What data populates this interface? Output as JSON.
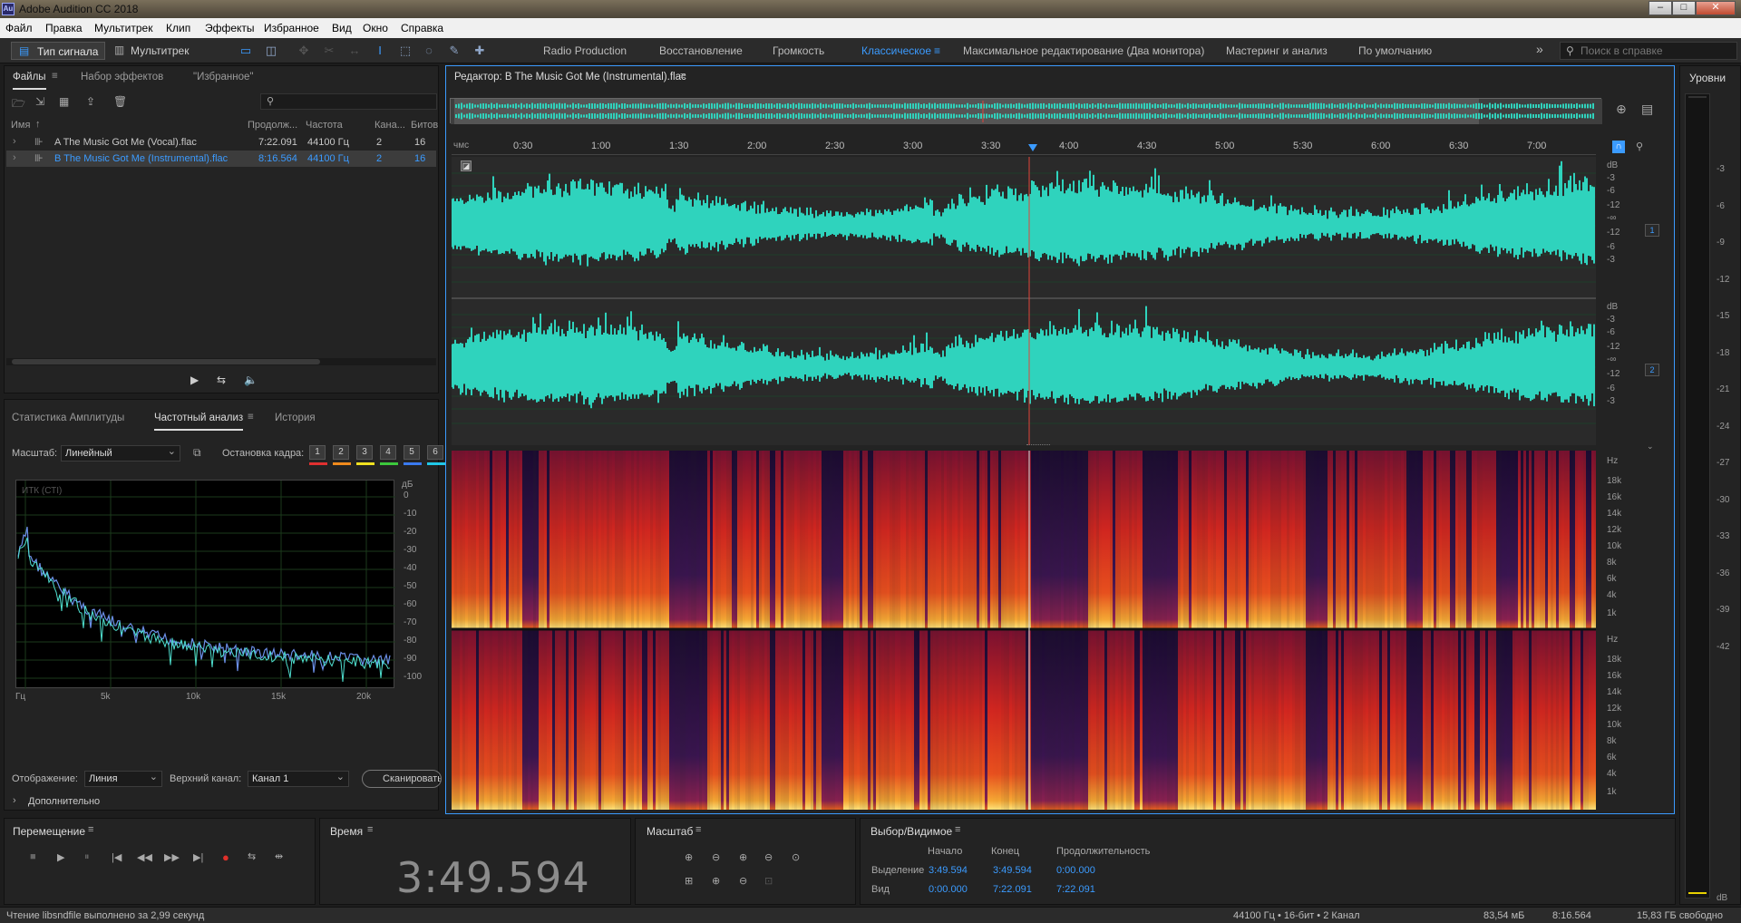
{
  "app": {
    "title": "Adobe Audition CC 2018",
    "logo": "Au"
  },
  "window_buttons": [
    "–",
    "□",
    "✕"
  ],
  "menu": [
    "Файл",
    "Правка",
    "Мультитрек",
    "Клип",
    "Эффекты",
    "Избранное",
    "Вид",
    "Окно",
    "Справка"
  ],
  "toolbar": {
    "mode_waveform": "Тип сигнала",
    "mode_multitrack": "Мультитрек",
    "workspaces": [
      "Radio Production",
      "Восстановление",
      "Громкость",
      "Классическое",
      "Максимальное редактирование (Два монитора)",
      "Мастеринг и анализ",
      "По умолчанию"
    ],
    "active_workspace": "Классическое",
    "more": "»",
    "search_placeholder": "Поиск в справке"
  },
  "files_panel": {
    "tabs": [
      "Файлы",
      "Набор эффектов",
      "\"Избранное\""
    ],
    "columns": [
      "Имя",
      "Продолж...",
      "Частота",
      "Кана...",
      "Битов"
    ],
    "rows": [
      {
        "name": "A The Music Got Me (Vocal).flac",
        "duration": "7:22.091",
        "rate": "44100 Гц",
        "channels": "2",
        "bits": "16",
        "selected": false
      },
      {
        "name": "B The Music Got Me (Instrumental).flac",
        "duration": "8:16.564",
        "rate": "44100 Гц",
        "channels": "2",
        "bits": "16",
        "selected": true
      }
    ]
  },
  "analysis_panel": {
    "tabs": [
      "Статистика Амплитуды",
      "Частотный анализ",
      "История"
    ],
    "scale_label": "Масштаб:",
    "scale_value": "Линейный",
    "freeze_label": "Остановка кадра:",
    "freeze_buttons": [
      "1",
      "2",
      "3",
      "4",
      "5",
      "6"
    ],
    "freeze_colors": [
      "#e03030",
      "#f08a1c",
      "#f0e020",
      "#3cc83c",
      "#3a7af0",
      "#20c8e8"
    ],
    "graph_label": "ИТК (СТI)",
    "db_unit": "дБ",
    "db_ticks": [
      "0",
      "-10",
      "-20",
      "-30",
      "-40",
      "-50",
      "-60",
      "-70",
      "-80",
      "-90",
      "-100"
    ],
    "freq_ticks": [
      "Гц",
      "5k",
      "10k",
      "15k",
      "20k"
    ],
    "display_label": "Отображение:",
    "display_value": "Линия",
    "channel_label": "Верхний канал:",
    "channel_value": "Канал 1",
    "scan_button": "Сканировать",
    "advanced": "Дополнительно"
  },
  "editor": {
    "title": "Редактор: B The Music Got Me (Instrumental).flac",
    "ruler_unit": "чмс",
    "ruler_ticks": [
      "0:30",
      "1:00",
      "1:30",
      "2:00",
      "2:30",
      "3:00",
      "3:30",
      "4:00",
      "4:30",
      "5:00",
      "5:30",
      "6:00",
      "6:30",
      "7:00"
    ],
    "db_scale": [
      "dB",
      "-3",
      "-6",
      "-12",
      "-∞",
      "-12",
      "-6",
      "-3"
    ],
    "channels": [
      "1",
      "2"
    ],
    "hz_scale": [
      "Hz",
      "18k",
      "16k",
      "14k",
      "12k",
      "10k",
      "8k",
      "6k",
      "4k",
      "1k"
    ]
  },
  "levels": {
    "title": "Уровни",
    "scale": [
      "-3",
      "-6",
      "-9",
      "-12",
      "-15",
      "-18",
      "-21",
      "-24",
      "-27",
      "-30",
      "-33",
      "-36",
      "-39",
      "-42",
      "dB"
    ]
  },
  "transport": {
    "title": "Перемещение",
    "buttons": [
      "■",
      "▶",
      "⏸",
      "|◀",
      "◀◀",
      "▶▶",
      "▶|",
      "●",
      "⇆",
      "⇹"
    ]
  },
  "time_panel": {
    "title": "Время",
    "value": "3:49.594"
  },
  "zoom_panel": {
    "title": "Масштаб"
  },
  "selection_panel": {
    "title": "Выбор/Видимое",
    "col_start": "Начало",
    "col_end": "Конец",
    "col_duration": "Продолжительность",
    "row_selection": {
      "label": "Выделение",
      "start": "3:49.594",
      "end": "3:49.594",
      "duration": "0:00.000"
    },
    "row_view": {
      "label": "Вид",
      "start": "0:00.000",
      "end": "7:22.091",
      "duration": "7:22.091"
    }
  },
  "status": {
    "left": "Чтение libsndfile выполнено за 2,99 секунд",
    "format": "44100 Гц • 16-бит • 2 Канал",
    "size": "83,54 мБ",
    "duration": "8:16.564",
    "free": "15,83 ГБ свободно"
  },
  "colors": {
    "accent": "#3b9bff",
    "waveform": "#2fd3bd",
    "playhead": "#e0443a"
  }
}
